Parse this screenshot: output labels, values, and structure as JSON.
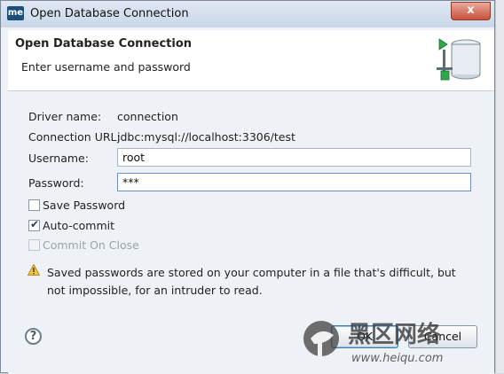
{
  "window": {
    "app_icon_text": "me",
    "title": "Open Database Connection",
    "close_label": "x"
  },
  "header": {
    "title": "Open Database Connection",
    "subtitle": "Enter username and password",
    "icon": "database-icon"
  },
  "form": {
    "driver_label": "Driver name:",
    "driver_value": "connection",
    "url_label": "Connection URL:",
    "url_value": "jdbc:mysql://localhost:3306/test",
    "username_label": "Username:",
    "username_value": "root",
    "password_label": "Password:",
    "password_value": "***"
  },
  "options": {
    "save_password": {
      "label": "Save Password",
      "checked": false,
      "enabled": true
    },
    "auto_commit": {
      "label": "Auto-commit",
      "checked": true,
      "enabled": true
    },
    "commit_on_close": {
      "label": "Commit On Close",
      "checked": false,
      "enabled": false
    }
  },
  "warning": {
    "icon": "warning-icon",
    "text": "Saved passwords are stored on your computer in a file that's difficult, but not impossible, for an intruder to read."
  },
  "buttons": {
    "help_label": "?",
    "ok_label": "OK",
    "cancel_label": "Cancel"
  },
  "watermark": {
    "text_cn": "黑区网络",
    "url": "www.heiqu.com"
  }
}
